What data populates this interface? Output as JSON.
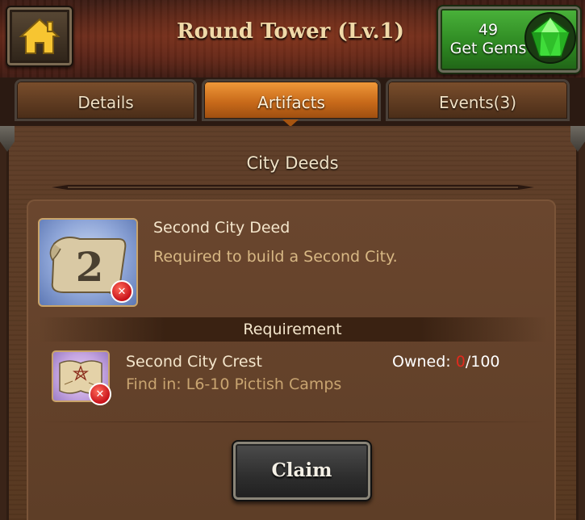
{
  "header": {
    "title": "Round Tower (Lv.1)",
    "home_icon": "home-icon",
    "gems": {
      "count": "49",
      "label": "Get Gems",
      "icon": "green-gem-icon"
    }
  },
  "tabs": [
    {
      "label": "Details",
      "active": false
    },
    {
      "label": "Artifacts",
      "active": true
    },
    {
      "label": "Events(3)",
      "active": false
    }
  ],
  "section": {
    "title": "City Deeds"
  },
  "artifact": {
    "name": "Second City Deed",
    "description": "Required to build a Second City.",
    "icon": "scroll-deed-icon",
    "status_icon": "missing-x-icon"
  },
  "requirement": {
    "heading": "Requirement",
    "item": {
      "name": "Second City Crest",
      "find_text": "Find in: L6-10 Pictish Camps",
      "owned_label": "Owned: ",
      "owned_current": "0",
      "owned_total": "/100",
      "icon": "crest-map-icon",
      "status_icon": "missing-x-icon"
    }
  },
  "actions": {
    "claim_label": "Claim"
  },
  "colors": {
    "active_tab": "#c86a1a",
    "gems_button": "#2f8a23",
    "owned_zero": "#e02a1e",
    "description_text": "#d8b884"
  }
}
